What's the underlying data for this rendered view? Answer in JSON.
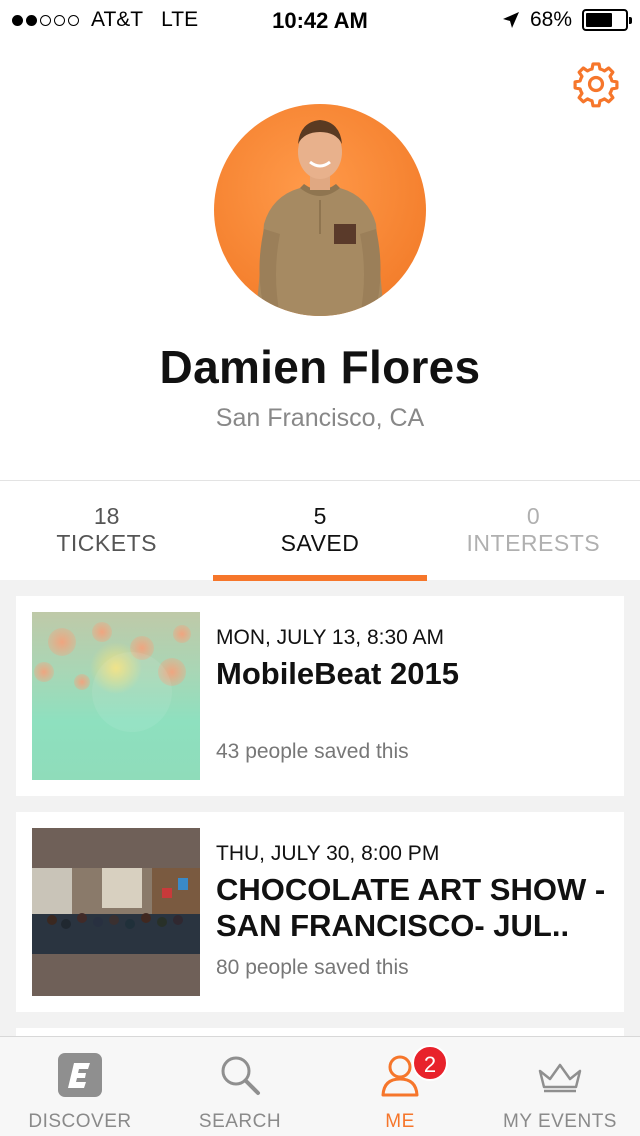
{
  "status_bar": {
    "carrier": "AT&T",
    "network": "LTE",
    "time": "10:42 AM",
    "battery": "68%",
    "battery_level": 0.68
  },
  "profile": {
    "name": "Damien Flores",
    "location": "San Francisco, CA",
    "settings_icon": "gear-icon"
  },
  "tabs": [
    {
      "count": "18",
      "label": "TICKETS"
    },
    {
      "count": "5",
      "label": "SAVED"
    },
    {
      "count": "0",
      "label": "INTERESTS"
    }
  ],
  "events": [
    {
      "date": "MON, JULY 13, 8:30 AM",
      "title": "MobileBeat 2015",
      "saved": "43 people saved this"
    },
    {
      "date": "THU, JULY 30, 8:00 PM",
      "title": "CHOCOLATE  ART SHOW -SAN FRANCISCO- JUL..",
      "saved": "80 people saved this"
    }
  ],
  "tabbar": {
    "discover": "DISCOVER",
    "search": "SEARCH",
    "me": "ME",
    "me_badge": "2",
    "my_events": "MY EVENTS"
  },
  "colors": {
    "accent": "#f6762b",
    "badge": "#e8222b"
  }
}
